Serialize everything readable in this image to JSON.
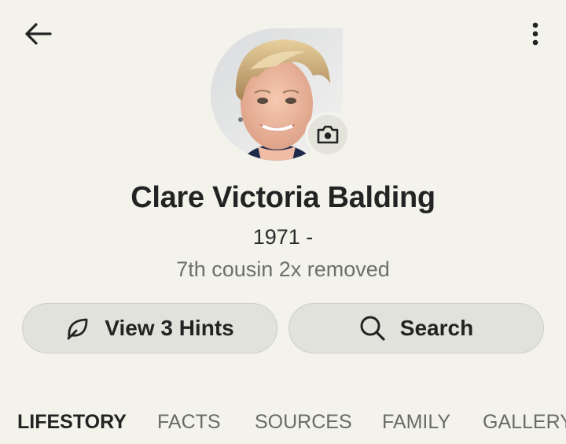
{
  "header": {
    "back_icon": "arrow-left-icon",
    "menu_icon": "more-vertical-icon"
  },
  "profile": {
    "photo_alt": "Profile photo of Clare Victoria Balding",
    "camera_icon": "camera-icon",
    "name": "Clare Victoria Balding",
    "years": "1971 -",
    "relationship": "7th cousin 2x removed"
  },
  "actions": {
    "hints_label": "View 3 Hints",
    "hints_icon": "leaf-icon",
    "search_label": "Search",
    "search_icon": "search-icon"
  },
  "tabs": [
    {
      "label": "LIFESTORY",
      "active": true
    },
    {
      "label": "FACTS",
      "active": false
    },
    {
      "label": "SOURCES",
      "active": false
    },
    {
      "label": "FAMILY",
      "active": false
    },
    {
      "label": "GALLERY",
      "active": false
    }
  ],
  "colors": {
    "background": "#f3f3ec",
    "pill_background": "#e2e2dc",
    "text_primary": "#232323",
    "text_secondary": "#6f6f6a"
  }
}
